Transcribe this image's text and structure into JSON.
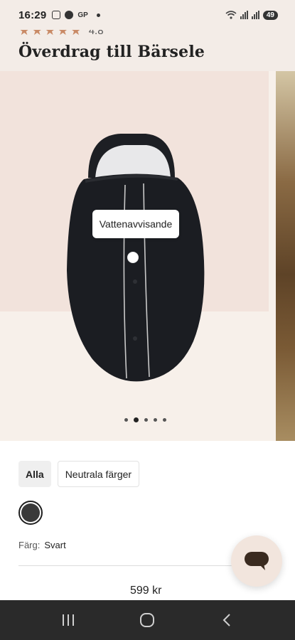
{
  "status_bar": {
    "time": "16:29",
    "carrier": "GP",
    "battery": "49"
  },
  "product": {
    "rating_stars": 5,
    "rating": "4.8",
    "title": "Överdrag till Bärsele"
  },
  "carousel": {
    "hotspot_label": "Vattenavvisande",
    "slide_count": 5,
    "active_slide": 1
  },
  "filters": [
    {
      "label": "Alla",
      "active": true
    },
    {
      "label": "Neutrala färger",
      "active": false
    }
  ],
  "color": {
    "label": "Färg:",
    "value": "Svart",
    "swatch_hex": "#3a3a3a"
  },
  "price": "599 kr",
  "colors": {
    "header_bg": "#f3ece7",
    "accent_star": "#c98a66",
    "nav_bg": "#2a2a2a"
  }
}
